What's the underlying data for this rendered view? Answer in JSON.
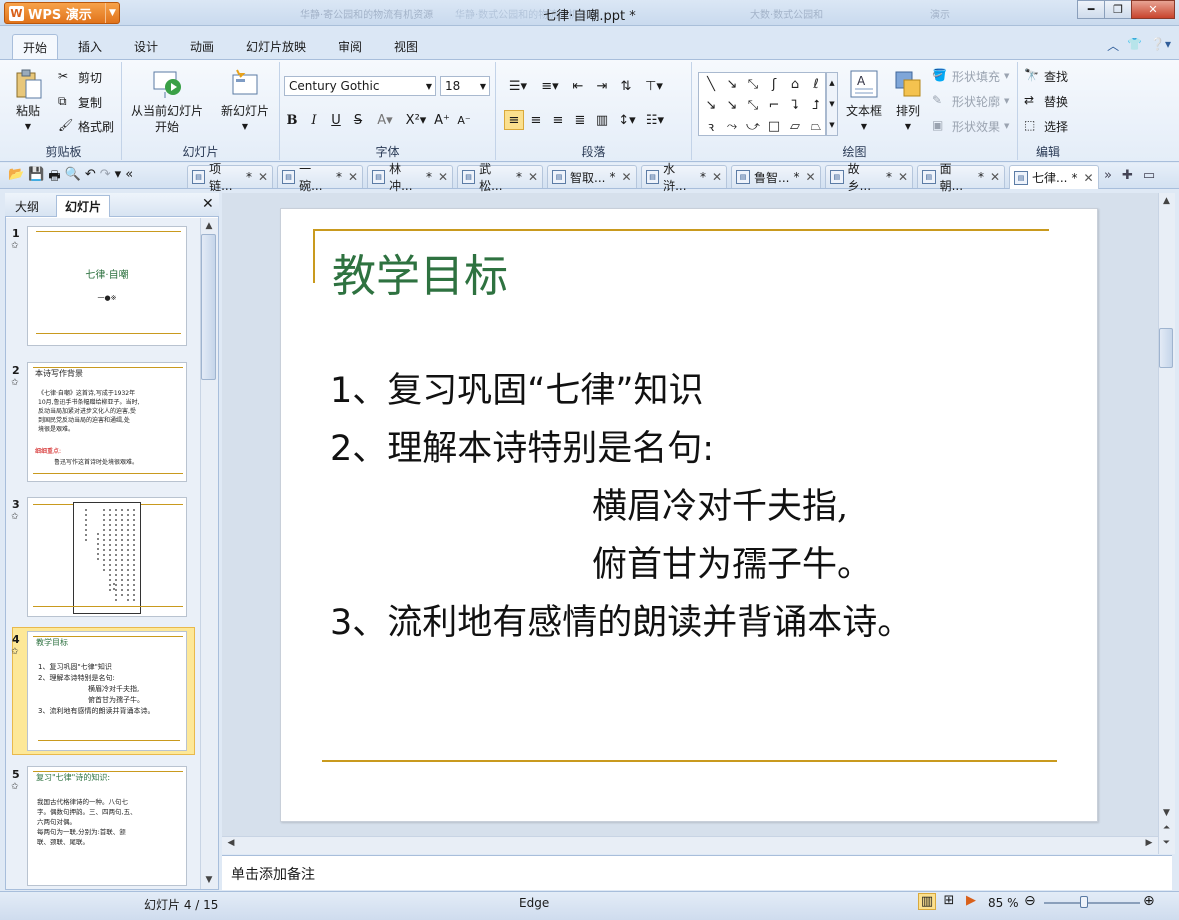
{
  "app": {
    "button_label": "WPS 演示",
    "window_title": "七律·自嘲.ppt *"
  },
  "ghost_tabs": [
    "华静·寄公园和的物流有机资源",
    "华静·数式公园和的物流有机资源",
    "大数·数式公园和",
    "演示"
  ],
  "menu": {
    "tabs": [
      "开始",
      "插入",
      "设计",
      "动画",
      "幻灯片放映",
      "审阅",
      "视图"
    ],
    "active": "开始"
  },
  "ribbon": {
    "clipboard": {
      "label": "剪贴板",
      "paste": "粘贴",
      "cut": "剪切",
      "copy": "复制",
      "format_painter": "格式刷"
    },
    "slides": {
      "label": "幻灯片",
      "from_current_line1": "从当前幻灯片",
      "from_current_line2": "开始",
      "new_slide": "新幻灯片"
    },
    "font": {
      "label": "字体",
      "family": "Century Gothic",
      "size": "18"
    },
    "paragraph": {
      "label": "段落"
    },
    "drawing": {
      "label": "绘图",
      "textbox": "文本框",
      "arrange": "排列",
      "shape_fill": "形状填充",
      "shape_outline": "形状轮廓",
      "shape_effect": "形状效果"
    },
    "edit": {
      "label": "编辑",
      "find": "查找",
      "replace": "替换",
      "select": "选择"
    }
  },
  "doc_tabs": [
    "项链...",
    "一碗...",
    "林冲...",
    "武松...",
    "智取...",
    "水浒...",
    "鲁智...",
    "故乡...",
    "面朝...",
    "七律..."
  ],
  "doc_tab_modified": "*",
  "panel": {
    "tab_outline": "大纲",
    "tab_slides": "幻灯片"
  },
  "thumbs": [
    {
      "num": "1",
      "title": "七律·自嘲",
      "sub": "一●※"
    },
    {
      "num": "2",
      "title": "本诗写作背景",
      "body": "《七律·自嘲》这首诗,写成于1932年\n10月,鲁迅手书条幅赠给柳亚子。当时,\n反动当局加紧对进步文化人的迫害,受\n到国民党反动当局的迫害和通缉,处\n境很是艰难。",
      "red": "细细重点:",
      "note": "鲁迅写作这首诗时处境很艰难。"
    },
    {
      "num": "3"
    },
    {
      "num": "4",
      "title": "教学目标",
      "lines": [
        "1、复习巩固\"七律\"知识",
        "2、理解本诗特别是名句:",
        "横眉冷对千夫指,",
        "俯首甘为孺子牛。",
        "3、流利地有感情的朗读并背诵本诗。"
      ]
    },
    {
      "num": "5",
      "title": "复习\"七律\"诗的知识:",
      "body": "我国古代格律诗的一种。八句七\n字。偶数句押韵。三、四两句,五、\n六两句对偶。\n每两句为一联,分别为:首联、颔\n联、颈联、尾联。"
    }
  ],
  "slide": {
    "title": "教学目标",
    "lines": [
      "1、复习巩固“七律”知识",
      "2、理解本诗特别是名句:",
      "横眉冷对千夫指,",
      "俯首甘为孺子牛。",
      "3、流利地有感情的朗读并背诵本诗。"
    ]
  },
  "notes_placeholder": "单击添加备注",
  "status": {
    "slide_counter": "幻灯片 4 / 15",
    "theme": "Edge",
    "zoom": "85 %"
  },
  "colors": {
    "title_green": "#2e7240",
    "accent_gold": "#c99a1e",
    "app_orange": "#e0731b"
  }
}
